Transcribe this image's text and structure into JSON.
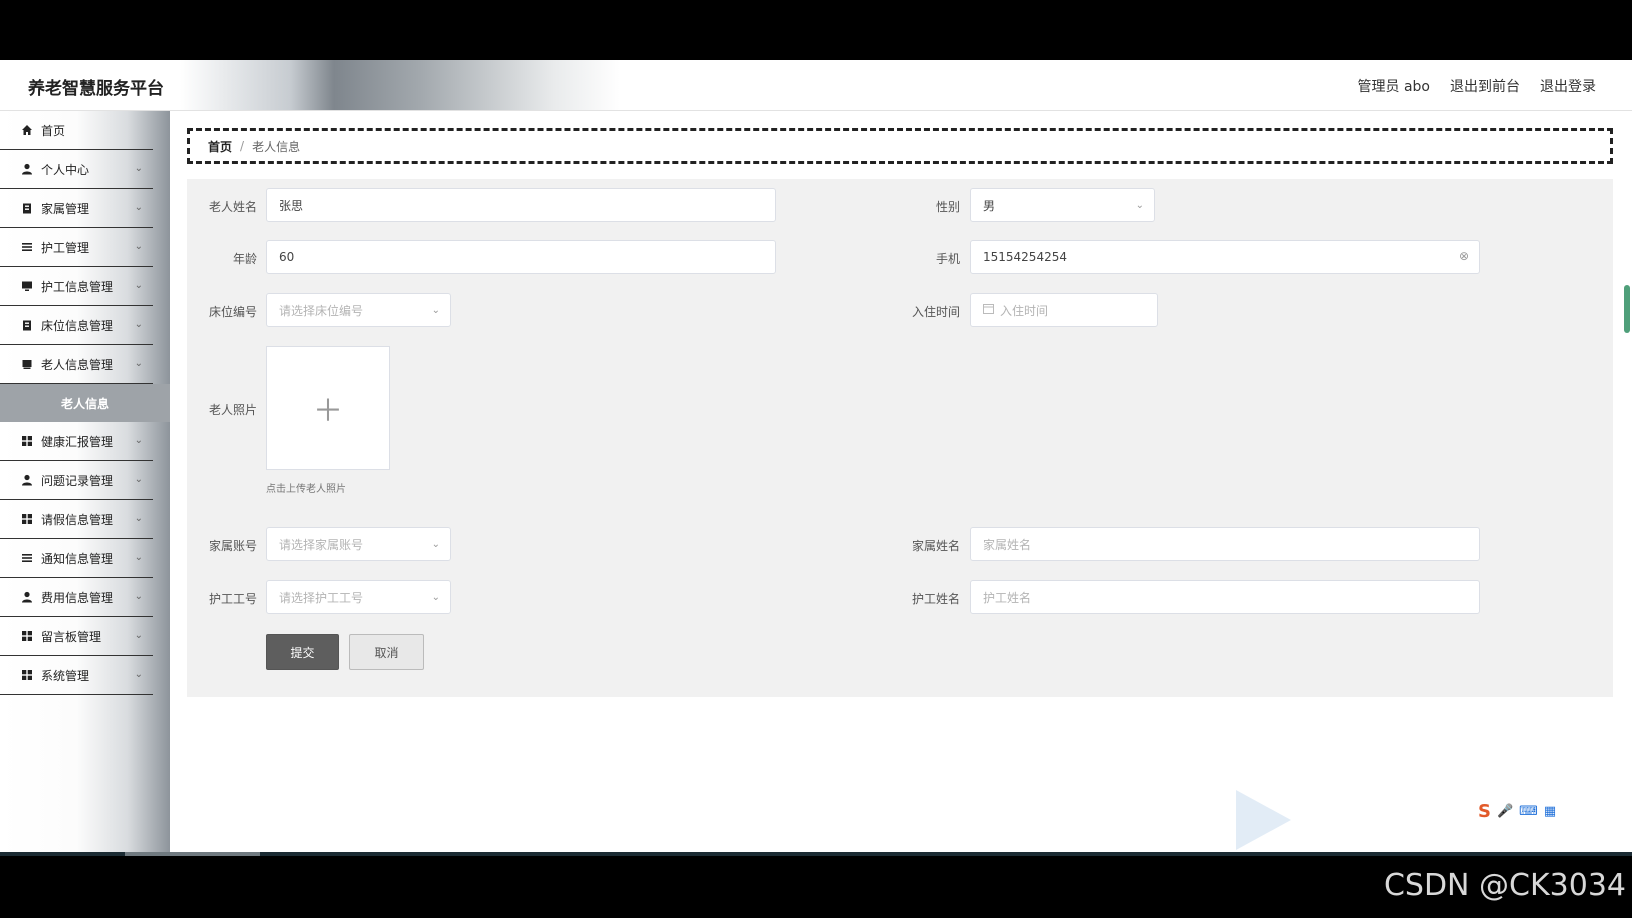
{
  "header": {
    "brand": "养老智慧服务平台",
    "admin": "管理员 abo",
    "to_front": "退出到前台",
    "logout": "退出登录"
  },
  "sidebar": {
    "items": [
      {
        "label": "首页",
        "icon": "home-icon"
      },
      {
        "label": "个人中心",
        "icon": "user-icon"
      },
      {
        "label": "家属管理",
        "icon": "clipboard-icon"
      },
      {
        "label": "护工管理",
        "icon": "list-icon"
      },
      {
        "label": "护工信息管理",
        "icon": "monitor-icon"
      },
      {
        "label": "床位信息管理",
        "icon": "clipboard-icon"
      },
      {
        "label": "老人信息管理",
        "icon": "folder-icon"
      },
      {
        "label": "健康汇报管理",
        "icon": "grid-icon"
      },
      {
        "label": "问题记录管理",
        "icon": "user-icon"
      },
      {
        "label": "请假信息管理",
        "icon": "grid-icon"
      },
      {
        "label": "通知信息管理",
        "icon": "list-icon"
      },
      {
        "label": "费用信息管理",
        "icon": "user-icon"
      },
      {
        "label": "留言板管理",
        "icon": "grid-icon"
      },
      {
        "label": "系统管理",
        "icon": "grid-icon"
      }
    ],
    "active_sub": "老人信息"
  },
  "breadcrumb": {
    "home": "首页",
    "sep": "/",
    "current": "老人信息"
  },
  "form": {
    "name_label": "老人姓名",
    "name_value": "张思",
    "gender_label": "性别",
    "gender_value": "男",
    "age_label": "年龄",
    "age_value": "60",
    "phone_label": "手机",
    "phone_value": "15154254254",
    "bed_label": "床位编号",
    "bed_placeholder": "请选择床位编号",
    "checkin_label": "入住时间",
    "checkin_placeholder": "入住时间",
    "photo_label": "老人照片",
    "photo_hint": "点击上传老人照片",
    "family_account_label": "家属账号",
    "family_account_placeholder": "请选择家属账号",
    "family_name_label": "家属姓名",
    "family_name_placeholder": "家属姓名",
    "nurse_id_label": "护工工号",
    "nurse_id_placeholder": "请选择护工工号",
    "nurse_name_label": "护工姓名",
    "nurse_name_placeholder": "护工姓名",
    "submit": "提交",
    "cancel": "取消"
  },
  "watermark": "CSDN @CK3034",
  "colors": {
    "primary_button": "#5e5e5e",
    "panel_bg": "#f1f1f1",
    "active_sub_bg": "#9ea3a8"
  }
}
